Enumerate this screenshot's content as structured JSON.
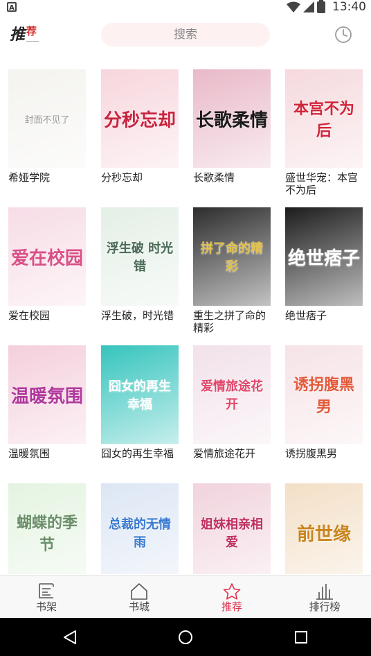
{
  "status_bar": {
    "time": "13:40",
    "app_badge": "A",
    "icons": [
      "wifi-icon",
      "signal-icon",
      "battery-icon"
    ]
  },
  "header": {
    "logo_main": "推",
    "logo_sub": "荐",
    "search_placeholder": "搜索",
    "history_icon": "clock-icon"
  },
  "books": [
    {
      "title": "希娅学院",
      "cover_text": "封面不见了",
      "bg": "#f4f3ef",
      "fg": "#9a9a9a"
    },
    {
      "title": "分秒忘却",
      "cover_text": "分秒忘却",
      "bg": "#f7d6dd",
      "fg": "#c9243f"
    },
    {
      "title": "长歌柔情",
      "cover_text": "长歌柔情",
      "bg": "#e9b9c8",
      "fg": "#1a1a1a"
    },
    {
      "title": "盛世华宠：本宫不为后",
      "cover_text": "本宫不为后",
      "bg": "#f5d9dd",
      "fg": "#d2243a"
    },
    {
      "title": "爱在校园",
      "cover_text": "爱在校园",
      "bg": "#f7dce6",
      "fg": "#d94f86"
    },
    {
      "title": "浮生破，时光错",
      "cover_text": "浮生破 时光错",
      "bg": "#e4efe6",
      "fg": "#4a6a55"
    },
    {
      "title": "重生之拼了命的精彩",
      "cover_text": "拼了命的精彩",
      "bg": "#2d2d2d",
      "fg": "#e4c14a"
    },
    {
      "title": "绝世痞子",
      "cover_text": "绝世痞子",
      "bg": "#1c1c1c",
      "fg": "#ffffff"
    },
    {
      "title": "温暖氛围",
      "cover_text": "温暖氛围",
      "bg": "#f4cfdc",
      "fg": "#b0389c"
    },
    {
      "title": "囧女的再生幸福",
      "cover_text": "囧女的再生幸福",
      "bg": "#36c4bd",
      "fg": "#ffffff"
    },
    {
      "title": "爱情旅途花开",
      "cover_text": "爱情旅途花开",
      "bg": "#f2e1ea",
      "fg": "#e0476a"
    },
    {
      "title": "诱拐腹黑男",
      "cover_text": "诱拐腹黑男",
      "bg": "#f6e3e6",
      "fg": "#e35a3a"
    },
    {
      "title": "",
      "cover_text": "蝴蝶的季节",
      "bg": "#e4f4e1",
      "fg": "#6a8f6a"
    },
    {
      "title": "",
      "cover_text": "总裁的无情雨",
      "bg": "#dce6f4",
      "fg": "#3a7ad0"
    },
    {
      "title": "",
      "cover_text": "姐妹相亲相爱",
      "bg": "#f1d3dc",
      "fg": "#c03060"
    },
    {
      "title": "",
      "cover_text": "前世缘",
      "bg": "#f3dfc6",
      "fg": "#c9851e"
    }
  ],
  "bottom_nav": [
    {
      "label": "书架",
      "icon": "bookshelf-icon",
      "active": false
    },
    {
      "label": "书城",
      "icon": "home-icon",
      "active": false
    },
    {
      "label": "推荐",
      "icon": "star-icon",
      "active": true
    },
    {
      "label": "排行榜",
      "icon": "bar-chart-icon",
      "active": false
    }
  ],
  "system_nav": [
    "back-icon",
    "home-circle-icon",
    "recents-icon"
  ],
  "colors": {
    "accent": "#e0324b",
    "search_bg": "#fdf1f2",
    "nav_bg": "#f8f8f8"
  }
}
